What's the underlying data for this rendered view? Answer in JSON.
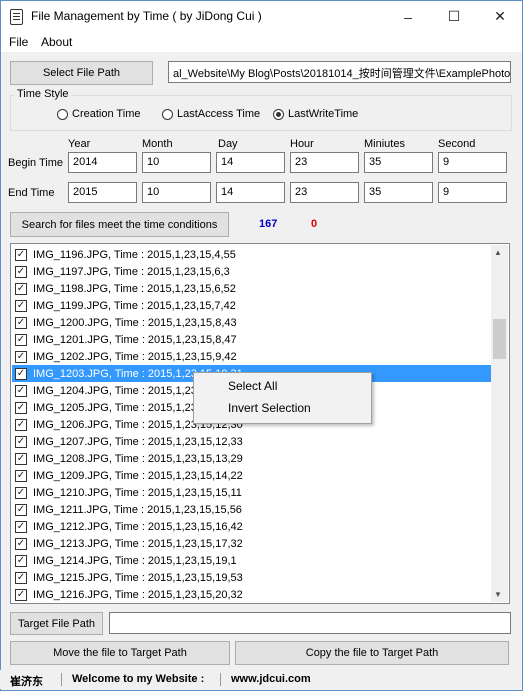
{
  "window": {
    "title": "File Management by Time ( by JiDong Cui )"
  },
  "menu": [
    "File",
    "About"
  ],
  "select_path_button": "Select File Path",
  "path_value": "al_Website\\My Blog\\Posts\\20181014_按时间管理文件\\ExamplePhoto",
  "time_style": {
    "label": "Time Style",
    "options": [
      "Creation Time",
      "LastAccess Time",
      "LastWriteTime"
    ],
    "selected": "LastWriteTime"
  },
  "columns": [
    "Year",
    "Month",
    "Day",
    "Hour",
    "Miniutes",
    "Second"
  ],
  "begin_label": "Begin Time",
  "end_label": "End Time",
  "begin_values": [
    "2014",
    "10",
    "14",
    "23",
    "35",
    "9"
  ],
  "end_values": [
    "2015",
    "10",
    "14",
    "23",
    "35",
    "9"
  ],
  "search_button": "Search for files meet the time conditions",
  "count_found": "167",
  "count_other": "0",
  "files": [
    "IMG_1196.JPG, Time : 2015,1,23,15,4,55",
    "IMG_1197.JPG, Time : 2015,1,23,15,6,3",
    "IMG_1198.JPG, Time : 2015,1,23,15,6,52",
    "IMG_1199.JPG, Time : 2015,1,23,15,7,42",
    "IMG_1200.JPG, Time : 2015,1,23,15,8,43",
    "IMG_1201.JPG, Time : 2015,1,23,15,8,47",
    "IMG_1202.JPG, Time : 2015,1,23,15,9,42",
    "IMG_1203.JPG, Time : 2015,1,23,15,10,31",
    "IMG_1204.JPG, Time : 2015,1,23",
    "IMG_1205.JPG, Time : 2015,1,23",
    "IMG_1206.JPG, Time : 2015,1,23,15,12,30",
    "IMG_1207.JPG, Time : 2015,1,23,15,12,33",
    "IMG_1208.JPG, Time : 2015,1,23,15,13,29",
    "IMG_1209.JPG, Time : 2015,1,23,15,14,22",
    "IMG_1210.JPG, Time : 2015,1,23,15,15,11",
    "IMG_1211.JPG, Time : 2015,1,23,15,15,56",
    "IMG_1212.JPG, Time : 2015,1,23,15,16,42",
    "IMG_1213.JPG, Time : 2015,1,23,15,17,32",
    "IMG_1214.JPG, Time : 2015,1,23,15,19,1",
    "IMG_1215.JPG, Time : 2015,1,23,15,19,53",
    "IMG_1216.JPG, Time : 2015,1,23,15,20,32"
  ],
  "selected_file_index": 7,
  "context_menu": [
    "Select All",
    "Invert Selection"
  ],
  "target_path_button": "Target File Path",
  "target_path_value": "",
  "move_button": "Move the file to Target Path",
  "copy_button": "Copy the file to Target Path",
  "status": {
    "name": "崔济东",
    "welcome": "Welcome to my Website :",
    "url": "www.jdcui.com"
  },
  "colors": {
    "count_found": "#0000cc",
    "count_other": "#e00000",
    "selection": "#3399ff"
  }
}
